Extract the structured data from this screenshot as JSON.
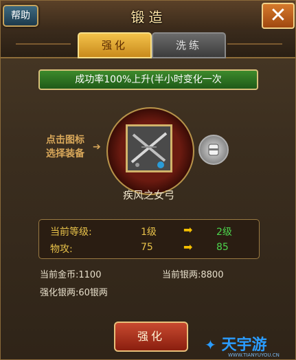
{
  "header": {
    "title": "锻造",
    "help_label": "帮助",
    "close_label": "✕"
  },
  "tabs": [
    {
      "label": "强化",
      "active": true
    },
    {
      "label": "洗练",
      "active": false
    }
  ],
  "banner": "成功率100%上升(半小时变化一次",
  "hint": {
    "line1": "点击图标",
    "line2": "选择装备"
  },
  "equipment": {
    "name": "疾风之女弓",
    "icon": "crossed-swords-weapon-icon",
    "side_icon": "helmet-icon"
  },
  "stats": {
    "rows": [
      {
        "label": "当前等级:",
        "from": "1级",
        "to": "2级"
      },
      {
        "label": "物攻:",
        "from": "75",
        "to": "85"
      }
    ]
  },
  "currency": {
    "gold_label": "当前金币:",
    "gold_value": "1100",
    "silver_label": "当前银两:",
    "silver_value": "8800",
    "cost_label": "强化银两:",
    "cost_value": "60银两"
  },
  "action": {
    "enhance_label": "强化"
  },
  "watermark": {
    "text": "天宇游",
    "url": "WWW.TIANYUYOU.CN"
  },
  "colors": {
    "accent": "#e8c24a",
    "increase": "#4cd44c",
    "banner": "#2f7224",
    "button": "#a8341e"
  }
}
